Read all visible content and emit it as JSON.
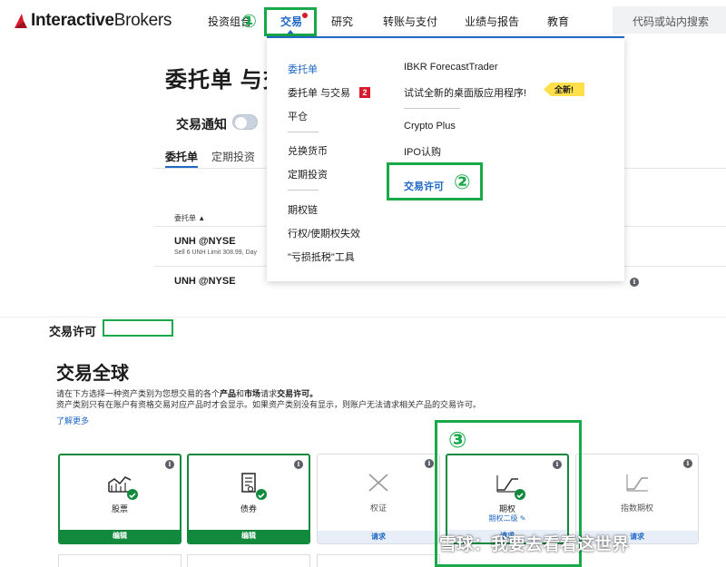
{
  "header": {
    "logo_bold": "Interactive",
    "logo_rest": "Brokers",
    "nav": [
      "投资组合",
      "交易",
      "研究",
      "转账与支付",
      "业绩与报告",
      "教育"
    ],
    "search_placeholder": "代码或站内搜索",
    "step1": "①"
  },
  "page": {
    "title": "委托单 与交",
    "notifications_label": "交易通知",
    "tabs": [
      "委托单",
      "定期投资"
    ],
    "column_orders": "委托单 ▲",
    "rows": [
      {
        "symbol": "UNH @NYSE",
        "detail": "Sell 6 UNH Limit 308.99, Day"
      },
      {
        "symbol": "UNH @NYSE",
        "detail": ""
      }
    ]
  },
  "dropdown": {
    "left": [
      "委托单",
      "委托单 与交易",
      "平仓",
      "兑换货币",
      "定期投资",
      "期权链",
      "行权/使期权失效",
      "\"亏损抵税\"工具"
    ],
    "left_badge": "2",
    "right": [
      "IBKR ForecastTrader",
      "试试全新的桌面版应用程序!",
      "Crypto Plus",
      "IPO认购",
      "交易许可"
    ],
    "new_badge": "全新!",
    "step2": "②"
  },
  "permissions": {
    "section_title": "交易许可",
    "heading": "交易全球",
    "desc1_a": "请在下方选择一种资产类别为您想交易的各个",
    "desc1_b": "产品",
    "desc1_c": "和",
    "desc1_d": "市场",
    "desc1_e": "请求",
    "desc1_f": "交易许可。",
    "desc2": "资产类别只有在账户有资格交易对应产品时才会显示。如果资产类别没有显示，则账户无法请求相关产品的交易许可。",
    "learn_more": "了解更多",
    "step3": "③",
    "cards": [
      {
        "label": "股票",
        "sub": "",
        "footer": "编辑",
        "enabled": true,
        "icon": "stocks-icon"
      },
      {
        "label": "债券",
        "sub": "",
        "footer": "编辑",
        "enabled": true,
        "icon": "bonds-icon"
      },
      {
        "label": "权证",
        "sub": "",
        "footer": "请求",
        "enabled": false,
        "icon": "warrants-icon"
      },
      {
        "label": "期权",
        "sub": "期权二级",
        "footer": "请求",
        "enabled": true,
        "icon": "options-icon"
      },
      {
        "label": "指数期权",
        "sub": "",
        "footer": "请求",
        "enabled": false,
        "icon": "index-options-icon"
      }
    ]
  },
  "watermark": "雪球：我要去看看这世界",
  "colors": {
    "accent": "#1f68c4",
    "green": "#19a84a",
    "dark_green": "#128a3e",
    "red": "#d81b2c",
    "yellow": "#ffe04b"
  }
}
